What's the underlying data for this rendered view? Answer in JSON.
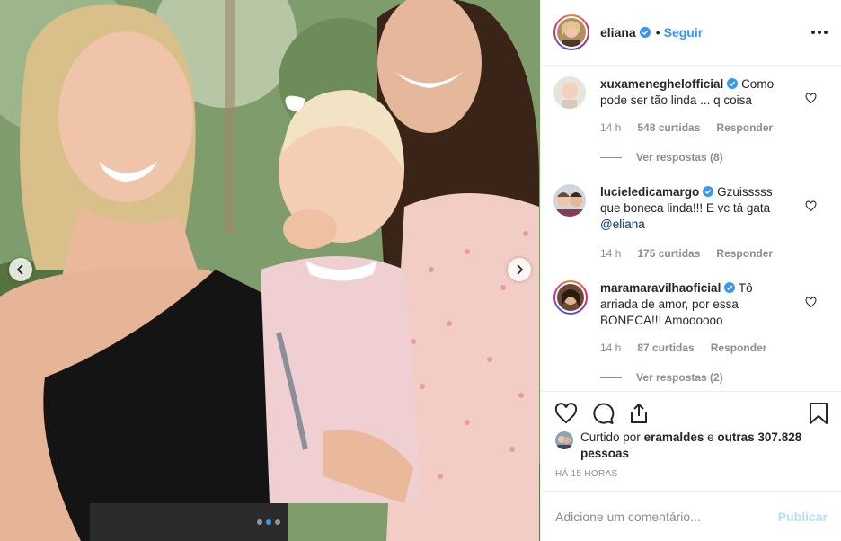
{
  "post": {
    "image_alt": "",
    "carousel": {
      "count": 3,
      "active_index": 1
    },
    "prev_icon": "chevron-left-icon",
    "next_icon": "chevron-right-icon"
  },
  "header": {
    "username": "eliana",
    "separator": "•",
    "follow_label": "Seguir",
    "more_icon": "more-horizontal-icon"
  },
  "comments": [
    {
      "username": "xuxameneghelofficial",
      "text": "Como pode ser tão linda ... q coisa",
      "time": "14 h",
      "likes": "548 curtidas",
      "reply_label": "Responder",
      "view_replies": "Ver respostas (8)"
    },
    {
      "username": "lucieledicamargo",
      "text": "Gzuisssss que boneca linda!!! E vc tá gata",
      "mention": "@eliana",
      "time": "14 h",
      "likes": "175 curtidas",
      "reply_label": "Responder"
    },
    {
      "username": "maramaravilhaoficial",
      "text": "Tô arriada de amor, por essa BONECA!!! Amoooooo",
      "time": "14 h",
      "likes": "87 curtidas",
      "reply_label": "Responder",
      "view_replies": "Ver respostas (2)"
    }
  ],
  "actions": {
    "like_icon": "heart-icon",
    "comment_icon": "comment-icon",
    "share_icon": "share-icon",
    "save_icon": "bookmark-icon"
  },
  "likes": {
    "prefix": "Curtido por",
    "user": "eramaldes",
    "connector": "e",
    "others": "outras 307.828 pessoas"
  },
  "timestamp": "HÁ 15 HORAS",
  "add_comment": {
    "placeholder": "Adicione um comentário...",
    "publish_label": "Publicar"
  },
  "colors": {
    "accent": "#3897f0",
    "publish_disabled": "#b2dffc",
    "muted": "#8e8e8e",
    "text": "#262626"
  }
}
